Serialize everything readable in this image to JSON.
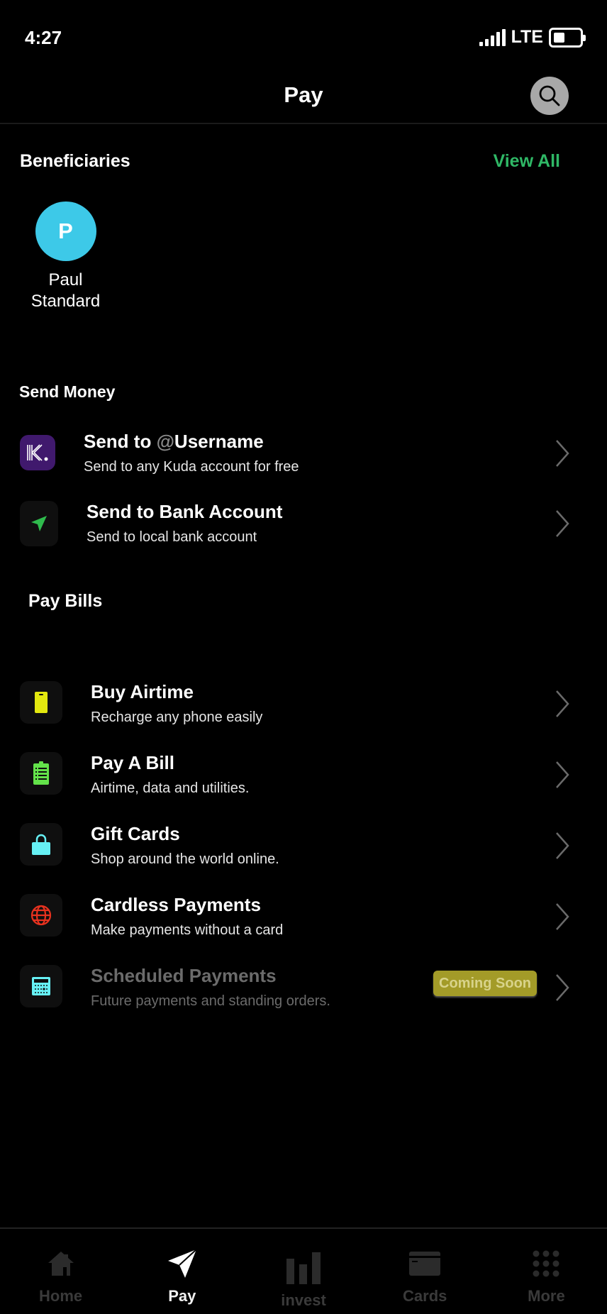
{
  "status_bar": {
    "time": "4:27",
    "network": "LTE",
    "battery_level": 0.45
  },
  "header": {
    "title": "Pay",
    "search_icon": "search-icon"
  },
  "beneficiaries": {
    "title": "Beneficiaries",
    "view_all_label": "View All",
    "items": [
      {
        "initial": "P",
        "name_line1": "Paul",
        "name_line2": "Standard",
        "color": "#3dc9e8"
      }
    ]
  },
  "send_money": {
    "title": "Send Money",
    "items": [
      {
        "title_prefix": "Send to ",
        "title_accent": "@",
        "title_suffix": "Username",
        "subtitle": "Send to any Kuda account for free",
        "icon": "kuda-logo-icon"
      },
      {
        "title": "Send to Bank Account",
        "subtitle": "Send to local bank account",
        "icon": "paper-plane-icon"
      }
    ]
  },
  "pay_bills": {
    "title": "Pay Bills",
    "items": [
      {
        "title": "Buy Airtime",
        "subtitle": "Recharge any phone easily",
        "icon": "phone-icon",
        "color": "#e3e80f"
      },
      {
        "title": "Pay A Bill",
        "subtitle": "Airtime, data and utilities.",
        "icon": "clipboard-list-icon",
        "color": "#63e24a"
      },
      {
        "title": "Gift Cards",
        "subtitle": "Shop around the world online.",
        "icon": "shopping-bag-icon",
        "color": "#66f0f4"
      },
      {
        "title": "Cardless Payments",
        "subtitle": "Make payments without a card",
        "icon": "globe-icon",
        "color": "#e8321f"
      },
      {
        "title": "Scheduled Payments",
        "subtitle": "Future payments and standing orders.",
        "icon": "calculator-icon",
        "color": "#66f0f4",
        "badge": "Coming Soon",
        "disabled": true
      }
    ]
  },
  "tabbar": {
    "tabs": [
      {
        "label": "Home",
        "icon": "home-icon",
        "active": false
      },
      {
        "label": "Pay",
        "icon": "paper-plane-icon",
        "active": true
      },
      {
        "label": "invest",
        "icon": "bar-chart-icon",
        "active": false
      },
      {
        "label": "Cards",
        "icon": "card-icon",
        "active": false
      },
      {
        "label": "More",
        "icon": "grid-dots-icon",
        "active": false
      }
    ]
  },
  "colors": {
    "accent_green": "#2fb866",
    "kuda_purple": "#40196d",
    "badge_bg": "#a39b28"
  }
}
